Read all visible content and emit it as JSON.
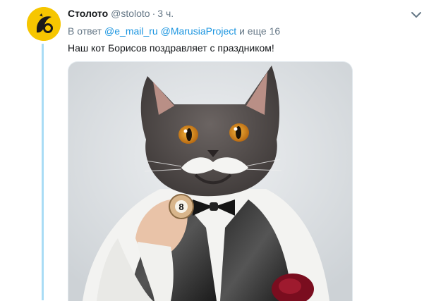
{
  "tweet": {
    "author_name": "Столото",
    "author_handle": "@stoloto",
    "separator": "·",
    "time": "3 ч.",
    "reply_prefix": "В ответ",
    "mention_1": "@e_mail_ru",
    "mention_2": "@MarusiaProject",
    "reply_suffix": "и еще 16",
    "text": "Наш кот Борисов поздравляет с праздником!",
    "ball_number": "8"
  },
  "colors": {
    "avatar": "#f6c600",
    "link": "#1b95e0",
    "thread_line": "#a9dcf5",
    "muted_text": "#657786"
  },
  "icons": {
    "avatar_logo": "stoloto-logo-icon",
    "menu_caret": "chevron-down-icon"
  }
}
